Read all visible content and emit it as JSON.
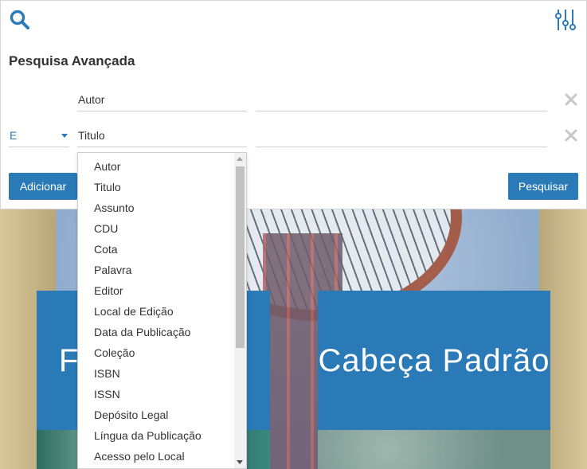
{
  "colors": {
    "accent": "#2a7ab8",
    "border": "#d6d6d6"
  },
  "topbar": {
    "search_icon": "search-icon",
    "filter_icon": "sliders-icon"
  },
  "panel": {
    "title": "Pesquisa Avançada",
    "rows": [
      {
        "operator": "",
        "field": "Autor",
        "value": ""
      },
      {
        "operator": "E",
        "field": "Titulo",
        "value": ""
      }
    ],
    "add_label": "Adicionar",
    "search_label": "Pesquisar"
  },
  "dropdown": {
    "options": [
      "Autor",
      "Titulo",
      "Assunto",
      "CDU",
      "Cota",
      "Palavra",
      "Editor",
      "Local de Edição",
      "Data da Publicação",
      "Coleção",
      "ISBN",
      "ISSN",
      "Depósito Legal",
      "Língua da Publicação",
      "Acesso pelo Local"
    ]
  },
  "hero": {
    "tile_left": "F",
    "tile_right": "Cabeça Padrão"
  }
}
